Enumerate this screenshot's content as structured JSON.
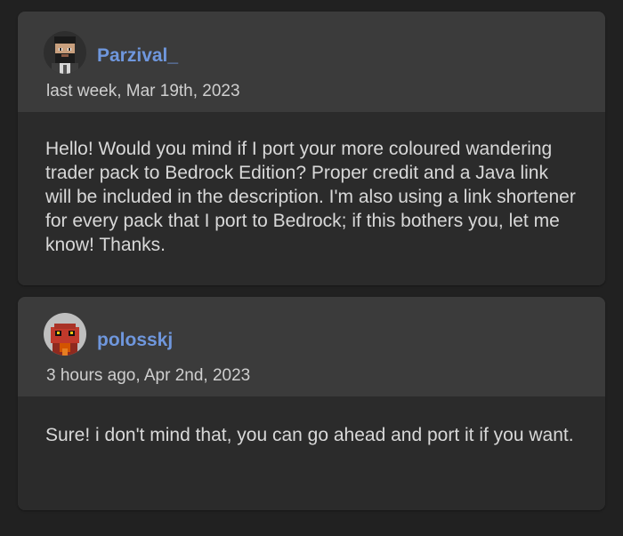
{
  "comments": [
    {
      "username": "Parzival_",
      "timestamp": "last week, Mar 19th, 2023",
      "avatar_icon": "pixel-avatar-bearded-man-icon",
      "body": "Hello! Would you mind if I port your more coloured wandering trader pack to Bedrock Edition? Proper credit and a Java link will be included in the description. I'm also using a link shortener for every pack that I port to Bedrock; if this bothers you, let me know! Thanks."
    },
    {
      "username": "polosskj",
      "timestamp": "3 hours ago, Apr 2nd, 2023",
      "avatar_icon": "pixel-avatar-red-creature-icon",
      "body": "Sure! i don't mind that, you can go ahead and port it if you want."
    }
  ],
  "colors": {
    "page_background": "#212121",
    "card_header": "#3b3b3b",
    "card_body": "#2b2b2b",
    "username_link": "#6f97dd",
    "body_text": "#d8d8d8",
    "timestamp_text": "#cfcfcf"
  }
}
